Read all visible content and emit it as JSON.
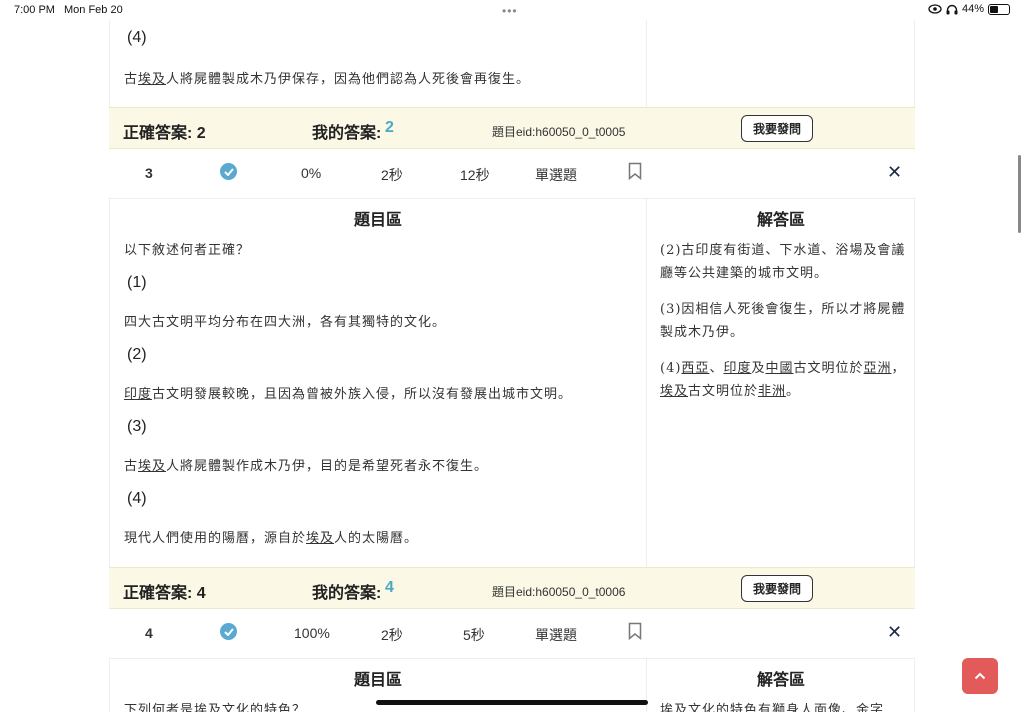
{
  "status": {
    "time": "7:00 PM",
    "date": "Mon Feb 20",
    "battery": "44%",
    "battery_level": 0.44
  },
  "q2_tail": {
    "option4_num": "(4)",
    "option4_pre": "古",
    "option4_u1": "埃及",
    "option4_post": "人將屍體製成木乃伊保存，因為他們認為人死後會再復生。"
  },
  "answer2": {
    "correct_label": "正確答案: 2",
    "mine_label": "我的答案:",
    "mine_value": "2",
    "eid": "題目eid:h60050_0_t0005",
    "ask": "我要發問"
  },
  "q3": {
    "num": "3",
    "rate": "0%",
    "my_time": "2秒",
    "avg_time": "12秒",
    "type": "單選題",
    "question_head": "題目區",
    "solution_head": "解答區",
    "question": "以下敘述何者正確？",
    "o1_num": "(1)",
    "o1": "四大古文明平均分布在四大洲，各有其獨特的文化。",
    "o2_num": "(2)",
    "o2_u": "印度",
    "o2": "古文明發展較晚，且因為曾被外族入侵，所以沒有發展出城市文明。",
    "o3_num": "(3)",
    "o3_pre": "古",
    "o3_u": "埃及",
    "o3": "人將屍體製作成木乃伊，目的是希望死者永不復生。",
    "o4_num": "(4)",
    "o4_pre": "現代人們使用的陽曆，源自於",
    "o4_u": "埃及",
    "o4": "人的太陽曆。",
    "s1_l1": "(2)古印度有街道、下水道、浴場及會議",
    "s1_l2": "廳等公共建築的城市文明。",
    "s2_l1": "(3)因相信人死後會復生，所以才將屍體",
    "s2_l2": "製成木乃伊。",
    "s3_pre": "(4)",
    "s3_u1": "西亞",
    "s3_sep1": "、",
    "s3_u2": "印度",
    "s3_sep2": "及",
    "s3_u3": "中國",
    "s3_mid": "古文明位於",
    "s3_u4": "亞洲",
    "s3_end1": "，",
    "s3_u5": "埃及",
    "s3_mid2": "古文明位於",
    "s3_u6": "非洲",
    "s3_end2": "。"
  },
  "answer3": {
    "correct_label": "正確答案: 4",
    "mine_label": "我的答案:",
    "mine_value": "4",
    "eid": "題目eid:h60050_0_t0006",
    "ask": "我要發問"
  },
  "q4": {
    "num": "4",
    "rate": "100%",
    "my_time": "2秒",
    "avg_time": "5秒",
    "type": "單選題",
    "question_head": "題目區",
    "solution_head": "解答區",
    "question": "下列何者是埃及文化的特色？",
    "solution": "埃及文化的特色有獅身人面像、金字"
  },
  "colors": {
    "accent": "#4aa8c8",
    "answer_bg": "#fbf8e6",
    "scroll_top_btn": "#e25a5a",
    "close": "#1f2a44"
  }
}
